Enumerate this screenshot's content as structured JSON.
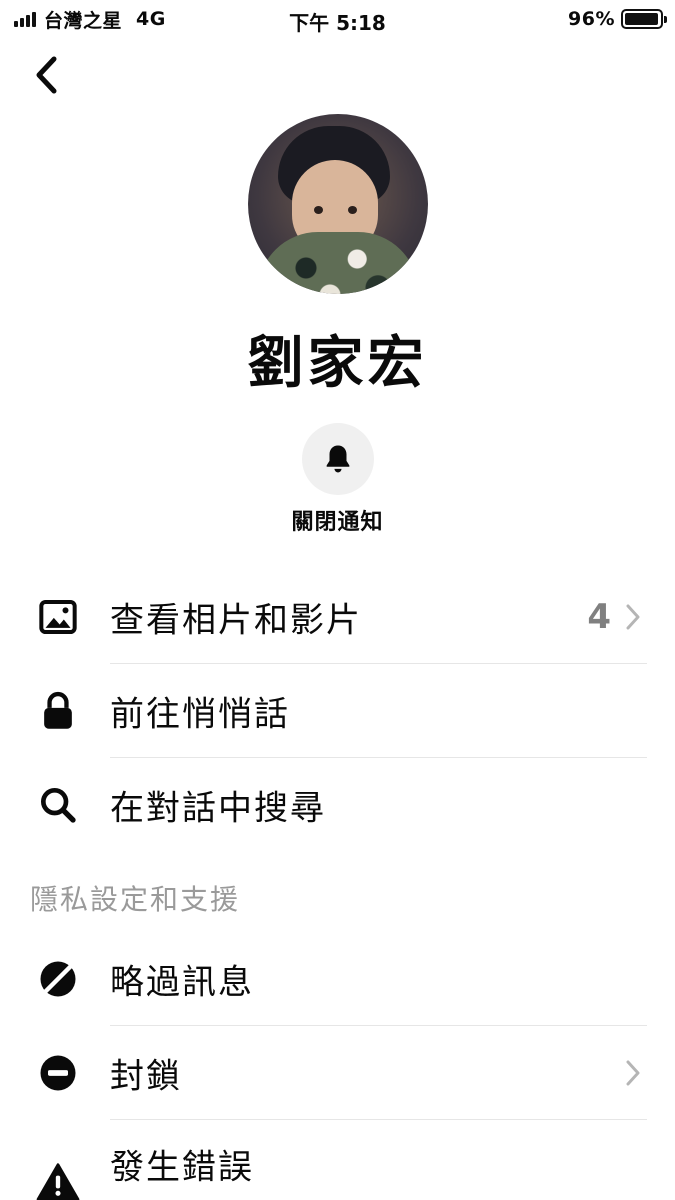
{
  "status_bar": {
    "carrier": "台灣之星",
    "network": "4G",
    "time": "下午 5:18",
    "battery": "96%",
    "battery_level": 0.96
  },
  "contact": {
    "name": "劉家宏"
  },
  "notifications": {
    "label": "關閉通知"
  },
  "menu": {
    "photos": {
      "label": "查看相片和影片",
      "count": "4"
    },
    "secret": {
      "label": "前往悄悄話"
    },
    "search": {
      "label": "在對話中搜尋"
    }
  },
  "privacy": {
    "header": "隱私設定和支援",
    "ignore": {
      "label": "略過訊息"
    },
    "block": {
      "label": "封鎖"
    },
    "report": {
      "label": "發生錯誤"
    }
  },
  "colors": {
    "text": "#0a0a0a",
    "muted": "#9a9a9a",
    "divider": "#e6e6e6",
    "button_bg": "#f0f0f0"
  }
}
